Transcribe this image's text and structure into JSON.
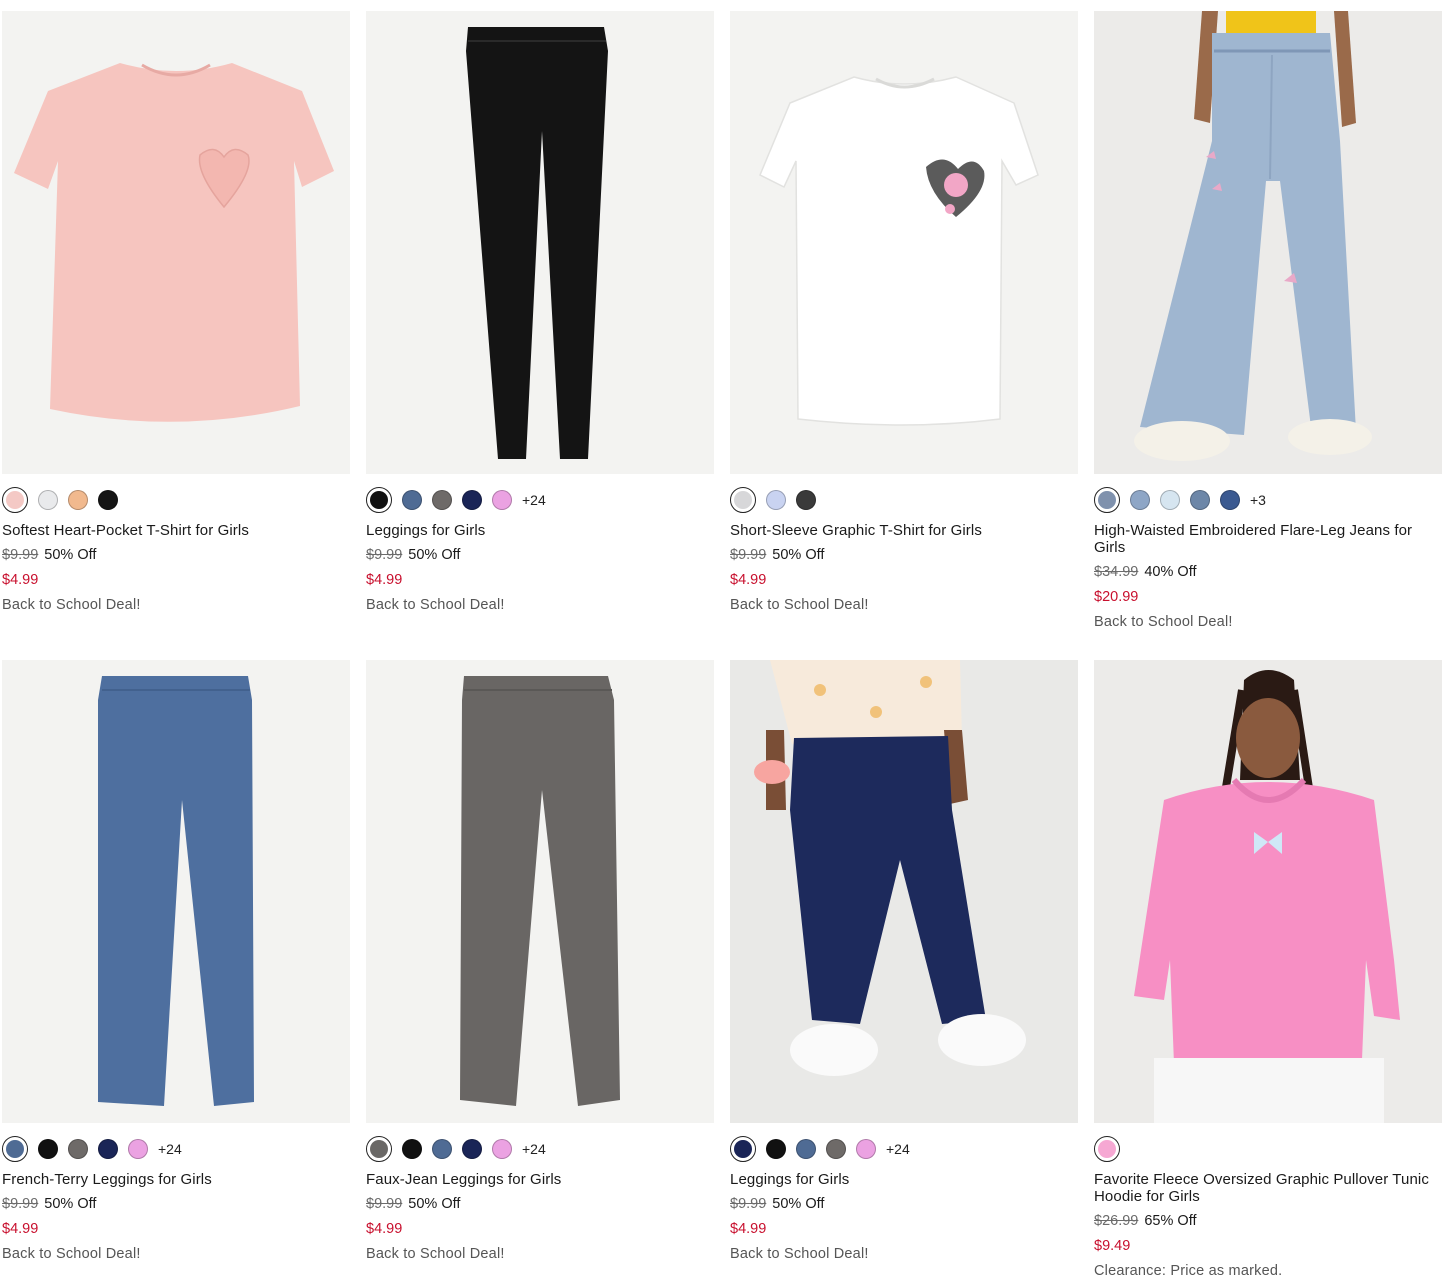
{
  "products": [
    {
      "name": "Softest Heart-Pocket T-Shirt for Girls",
      "original_price": "$9.99",
      "discount": "50% Off",
      "sale_price": "$4.99",
      "promo": "Back to School Deal!",
      "swatches": [
        "#f4c9c5",
        "#e9eaec",
        "#f1b98e",
        "#151515"
      ],
      "more": "",
      "image": "pink-heart-pocket-tshirt"
    },
    {
      "name": "Leggings for Girls",
      "original_price": "$9.99",
      "discount": "50% Off",
      "sale_price": "$4.99",
      "promo": "Back to School Deal!",
      "swatches": [
        "#111111",
        "#4f6b94",
        "#6e6a68",
        "#1a2557",
        "#eba2e2"
      ],
      "more": "+24",
      "image": "black-leggings"
    },
    {
      "name": "Short-Sleeve Graphic T-Shirt for Girls",
      "original_price": "$9.99",
      "discount": "50% Off",
      "sale_price": "$4.99",
      "promo": "Back to School Deal!",
      "swatches": [
        "#d7d7d9",
        "#c9d3f1",
        "#3a3a3a"
      ],
      "more": "",
      "image": "white-graphic-tshirt"
    },
    {
      "name": "High-Waisted Embroidered Flare-Leg Jeans for Girls",
      "original_price": "$34.99",
      "discount": "40% Off",
      "sale_price": "$20.99",
      "promo": "Back to School Deal!",
      "swatches": [
        "#7f91ad",
        "#8ea6c6",
        "#d6e5f0",
        "#6d87a8",
        "#3b5a91"
      ],
      "more": "+3",
      "image": "flare-jeans-model"
    },
    {
      "name": "French-Terry Leggings for Girls",
      "original_price": "$9.99",
      "discount": "50% Off",
      "sale_price": "$4.99",
      "promo": "Back to School Deal!",
      "swatches": [
        "#4f6b94",
        "#111111",
        "#6e6a68",
        "#1a2557",
        "#eba2e2"
      ],
      "more": "+24",
      "image": "blue-french-terry-leggings"
    },
    {
      "name": "Faux-Jean Leggings for Girls",
      "original_price": "$9.99",
      "discount": "50% Off",
      "sale_price": "$4.99",
      "promo": "Back to School Deal!",
      "swatches": [
        "#6a6866",
        "#111111",
        "#4f6b94",
        "#1a2557",
        "#eba2e2"
      ],
      "more": "+24",
      "image": "grey-faux-jean-leggings"
    },
    {
      "name": "Leggings for Girls",
      "original_price": "$9.99",
      "discount": "50% Off",
      "sale_price": "$4.99",
      "promo": "Back to School Deal!",
      "swatches": [
        "#1a2557",
        "#111111",
        "#4f6b94",
        "#6e6a68",
        "#eba2e2"
      ],
      "more": "+24",
      "image": "navy-leggings-model"
    },
    {
      "name": "Favorite Fleece Oversized Graphic Pullover Tunic Hoodie for Girls",
      "original_price": "$26.99",
      "discount": "65% Off",
      "sale_price": "$9.49",
      "promo": "Clearance: Price as marked.",
      "swatches": [
        "#f6a8d3"
      ],
      "more": "",
      "image": "pink-hoodie-model"
    }
  ]
}
